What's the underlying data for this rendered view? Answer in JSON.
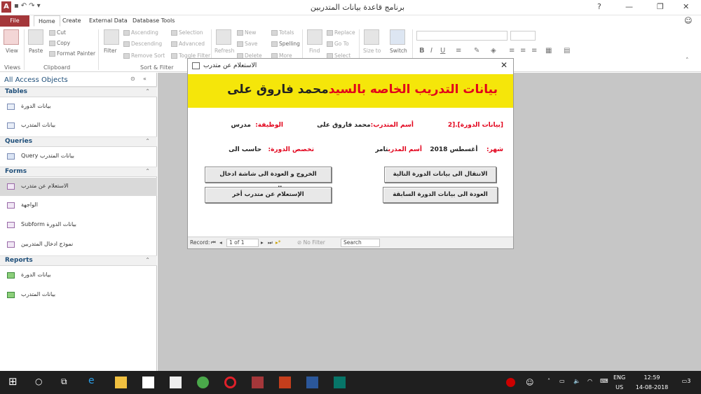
{
  "window": {
    "title": "برنامج قاعدة بيانات المتدربين",
    "help": "?",
    "minimize": "—",
    "restore": "❐",
    "close": "✕"
  },
  "ribbon_tabs": [
    {
      "label": "File"
    },
    {
      "label": "Home"
    },
    {
      "label": "Create"
    },
    {
      "label": "External Data"
    },
    {
      "label": "Database Tools"
    }
  ],
  "ribbon": {
    "views": {
      "view": "View",
      "group": "Views"
    },
    "clipboard": {
      "paste": "Paste",
      "cut": "Cut",
      "copy": "Copy",
      "format_painter": "Format Painter",
      "group": "Clipboard"
    },
    "sort_filter": {
      "filter": "Filter",
      "ascending": "Ascending",
      "descending": "Descending",
      "remove_sort": "Remove Sort",
      "selection": "Selection",
      "advanced": "Advanced",
      "toggle_filter": "Toggle Filter",
      "group": "Sort & Filter"
    },
    "records": {
      "refresh": "Refresh",
      "new": "New",
      "save": "Save",
      "delete": "Delete",
      "totals": "Totals",
      "spelling": "Spelling",
      "more": "More"
    },
    "find": {
      "find": "Find",
      "replace": "Replace",
      "goto": "Go To",
      "select": "Select"
    },
    "window": {
      "size_to_fit": "Size to",
      "switch": "Switch"
    }
  },
  "nav": {
    "title": "All Access Objects",
    "sections": [
      {
        "label": "Tables",
        "items": [
          {
            "label": "بيانات الدورة"
          },
          {
            "label": "بيانات المتدرب"
          }
        ]
      },
      {
        "label": "Queries",
        "items": [
          {
            "label": "بيانات المتدرب Query"
          }
        ]
      },
      {
        "label": "Forms",
        "items": [
          {
            "label": "الاستعلام عن متدرب"
          },
          {
            "label": "الواجهة"
          },
          {
            "label": "بيانات الدورة Subform"
          },
          {
            "label": "نموذج ادخال المتدربين"
          }
        ]
      },
      {
        "label": "Reports",
        "items": [
          {
            "label": "بيانات الدورة"
          },
          {
            "label": "بيانات المتدرب"
          }
        ]
      }
    ]
  },
  "dialog": {
    "title": "الاستعلام عن متدرب",
    "header_prefix": "بيانات التدريب الخاصه بالسيد",
    "header_name": "محمد فاروق على",
    "fields": {
      "course_label": "[بيانات الدورة].[2",
      "trainee_label": "أسم المتدرب:",
      "trainee_value": "محمد فاروق على",
      "job_label": "الوظيفة:",
      "job_value": "مدرس",
      "month_label": "شهر:",
      "month_value": "أغسطس 2018",
      "trainer_label": "أسم المدرب",
      "trainer_value": "تامر",
      "specialty_label": "تخصص الدورة:",
      "specialty_value": "حاسب الى"
    },
    "buttons": {
      "next_course": "الانتقال الى بيانات الدورة التالية",
      "exit": "الخروج و العودة الى شاشة ادخال المتدربين",
      "prev_course": "العودة الى بيانات الدورة السابقة",
      "other_trainee": "الإستعلام عن متدرب أخر"
    },
    "record_bar": {
      "label": "Record:",
      "position": "1 of 1",
      "filter": "No Filter",
      "search": "Search"
    }
  },
  "taskbar": {
    "lang": "ENG",
    "region": "US",
    "time": "12:59",
    "date": "14-08-2018",
    "notif": "3"
  },
  "colors": {
    "access_accent": "#a4373a",
    "header_yellow": "#f5e60a",
    "label_red": "#e2001a",
    "nav_blue": "#1e4e79"
  }
}
